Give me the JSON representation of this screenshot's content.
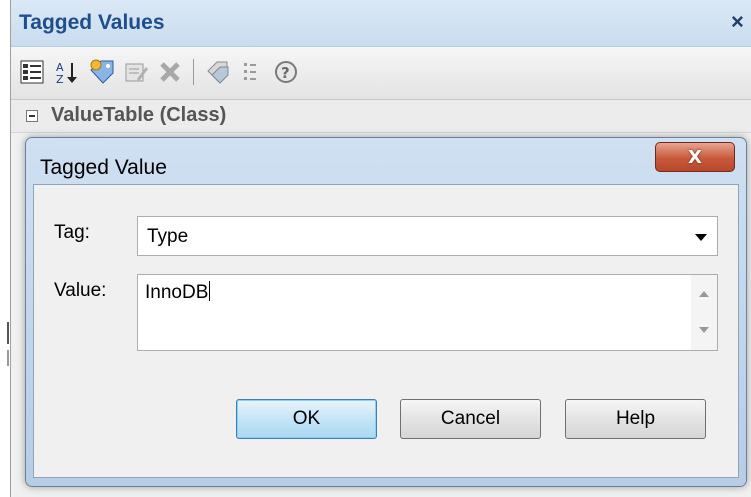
{
  "panel": {
    "title": "Tagged Values",
    "close_glyph": "×",
    "toolbar": [
      "categorized-view-icon",
      "sort-alphabetical-icon",
      "new-tag-icon",
      "edit-tag-icon",
      "delete-icon",
      "show-inherited-icon",
      "filter-icon",
      "help-icon"
    ],
    "group_label": "ValueTable (Class)"
  },
  "dialog": {
    "title": "Tagged Value",
    "close_glyph": "X",
    "tag_label": "Tag:",
    "tag_value": "Type",
    "value_label": "Value:",
    "value_text": "InnoDB",
    "ok_label": "OK",
    "cancel_label": "Cancel",
    "help_label": "Help"
  },
  "colors": {
    "panel_title_text": "#1f4e8c",
    "dialog_frame": "#b7cde6",
    "close_button": "#c85a3c",
    "default_button": "#a9d8f3"
  }
}
